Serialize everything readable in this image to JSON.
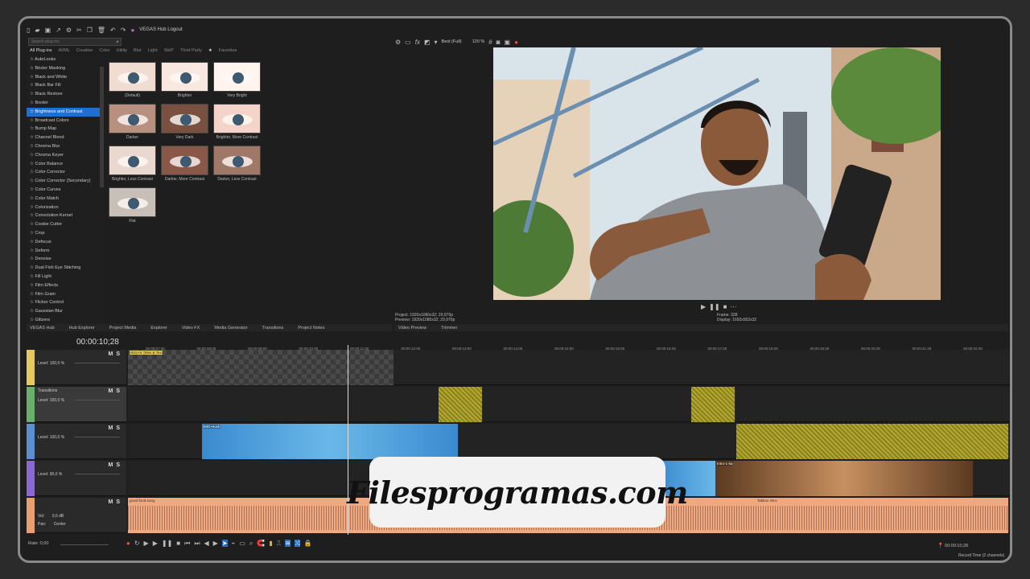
{
  "app": {
    "title": "VEGAS Hub Logout"
  },
  "plugins": {
    "search_placeholder": "Search plug-ins",
    "tabs": [
      "All Plug-ins",
      "AI/ML",
      "Creative",
      "Color",
      "Utility",
      "Blur",
      "Light",
      "Skill*",
      "Third Party",
      "Favorites"
    ],
    "items": [
      "AutoLooks",
      "Bézier Masking",
      "Black and White",
      "Black Bar Fill",
      "Black Restore",
      "Border",
      "Brightness and Contrast",
      "Broadcast Colors",
      "Bump Map",
      "Channel Blend",
      "Chroma Blur",
      "Chroma Keyer",
      "Color Balance",
      "Color Corrector",
      "Color Corrector (Secondary)",
      "Color Curves",
      "Color Match",
      "Colorization",
      "Convolution Kernel",
      "Cookie Cutter",
      "Crop",
      "Defocus",
      "Deform",
      "Denoise",
      "Dual Fish Eye Stitching",
      "Fill Light",
      "Film Effects",
      "Film Grain",
      "Flicker Control",
      "Gaussian Blur",
      "Glitzers"
    ],
    "selected_index": 6,
    "presets": [
      "(Default)",
      "Brighter",
      "Very Bright",
      "Darker",
      "Very Dark",
      "Brighter, More Contrast",
      "Brighter, Less Contrast",
      "Darker, More Contrast",
      "Darker, Less Contrast",
      "Flat"
    ]
  },
  "preview": {
    "quality": "Best (Full)",
    "zoom": "120 %",
    "project_label": "Project:",
    "project_value": "1920x1080x32; 29,970p",
    "preview_label": "Preview:",
    "preview_value": "1920x1080x32; 29,970p",
    "frame_label": "Frame:",
    "frame_value": "328",
    "display_label": "Display:",
    "display_value": "1692x952x32"
  },
  "left_tabs": [
    "VEGAS Hub",
    "Hub Explorer",
    "Project Media",
    "Explorer",
    "Video FX",
    "Media Generator",
    "Transitions",
    "Project Notes"
  ],
  "right_tabs": [
    "Video Preview",
    "Trimmer"
  ],
  "timeline": {
    "timecode": "00:00:10;28",
    "ruler": [
      "00:00:07;00",
      "00:00:08;00",
      "00:00:09;00",
      "00:00:10;00",
      "00:00:11;00",
      "00:00:12;00",
      "00:00:13;00",
      "00:00:14;00",
      "00:00:15;00",
      "00:00:16;00",
      "00:00:16;29",
      "00:00:17;29",
      "00:00:18;29",
      "00:00:19;29",
      "00:00:20;29",
      "00:00:21;29",
      "00:00:22;29"
    ],
    "tracks": [
      {
        "color": "#e8c860",
        "name": "",
        "level": "Level: 100,0 %",
        "clip": "VEGAS Titles & Text"
      },
      {
        "color": "#6ab06a",
        "name": "Transitions",
        "level": "Level: 100,0 %",
        "clip": ""
      },
      {
        "color": "#5a90d0",
        "name": "",
        "level": "Level: 100,0 %",
        "clip": "IMG-Hoch"
      },
      {
        "color": "#8a6ad0",
        "name": "",
        "level": "Level: 90,0 %",
        "clip": "Intro-1-5a"
      },
      {
        "color": "#e8a070",
        "name": "",
        "vol_label": "Vol:",
        "vol": "0,0 dB",
        "pan_label": "Pan:",
        "pan": "Center",
        "clip": "good-food-song",
        "clip2": "Takbox Intro"
      }
    ],
    "rate": "Rate: 0,00",
    "end_time": "00:00:10;28",
    "record_time": "Record Time (2 channels)"
  },
  "watermark": "Filesprogramas.com",
  "labels": {
    "m": "M",
    "s": "S",
    "fx": "fx"
  }
}
